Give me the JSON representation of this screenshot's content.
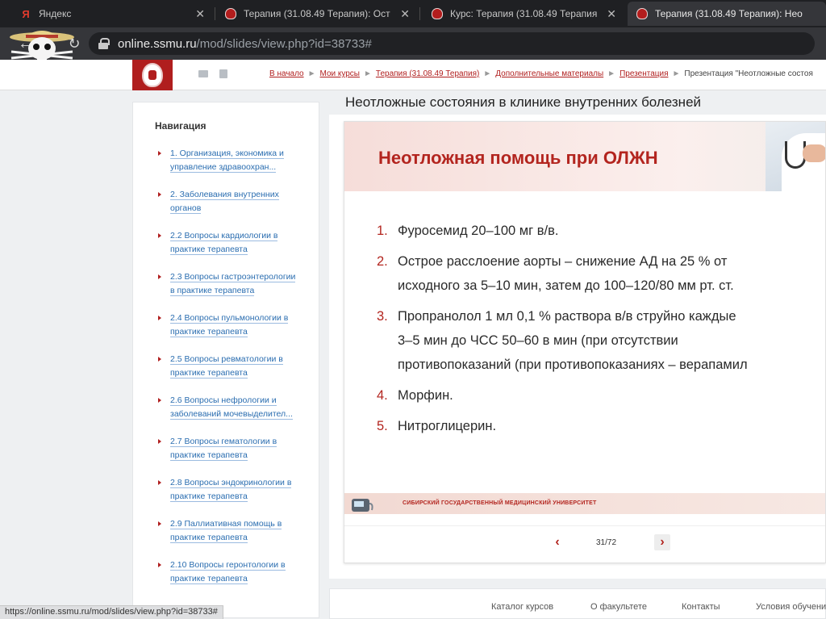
{
  "browser": {
    "tabs": [
      {
        "icon": "yandex-icon",
        "title": "Яндекс"
      },
      {
        "icon": "ssmu-crest-icon",
        "title": "Терапия (31.08.49 Терапия): Ост"
      },
      {
        "icon": "ssmu-crest-icon",
        "title": "Курс: Терапия (31.08.49 Терапия"
      },
      {
        "icon": "ssmu-crest-icon",
        "title": "Терапия (31.08.49 Терапия): Нео"
      }
    ],
    "url_host": "online.ssmu.ru",
    "url_path": "/mod/slides/view.php?id=38733#",
    "status_url": "https://online.ssmu.ru/mod/slides/view.php?id=38733#"
  },
  "header": {
    "breadcrumb": [
      "В начало",
      "Мои курсы",
      "Терапия (31.08.49 Терапия)",
      "Дополнительные материалы",
      "Презентация"
    ],
    "breadcrumb_current": "Презентация \"Неотложные состоя"
  },
  "sidebar": {
    "title": "Навигация",
    "items": [
      {
        "label": "1. Организация, экономика и управление здравоохран..."
      },
      {
        "label": "2. Заболевания внутренних органов"
      },
      {
        "label": "2.2 Вопросы кардиологии в практике терапевта"
      },
      {
        "label": "2.3 Вопросы гастроэнтерологии в практике терапевта"
      },
      {
        "label": "2.4 Вопросы пульмонологии в практике терапевта"
      },
      {
        "label": "2.5 Вопросы ревматологии в практике терапевта"
      },
      {
        "label": "2.6 Вопросы нефрологии и заболеваний мочевыделител..."
      },
      {
        "label": "2.7 Вопросы гематологии в практике терапевта"
      },
      {
        "label": "2.8 Вопросы эндокринологии в практике терапевта"
      },
      {
        "label": "2.9 Паллиативная помощь в практике терапевта"
      },
      {
        "label": "2.10 Вопросы геронтологии в практике терапевта"
      }
    ]
  },
  "main": {
    "page_title": "Неотложные состояния в клинике внутренних болезней",
    "slide": {
      "heading": "Неотложная помощь при ОЛЖН",
      "items": [
        {
          "num": "1.",
          "lines": [
            "Фуросемид 20–100 мг в/в."
          ]
        },
        {
          "num": "2.",
          "lines": [
            "Острое расслоение аорты – снижение АД на 25 % от",
            "исходного за 5–10 мин, затем до 100–120/80 мм рт. ст."
          ]
        },
        {
          "num": "3.",
          "lines": [
            "Пропранолол 1 мл 0,1 % раствора в/в струйно каждые",
            "3–5 мин до ЧСС 50–60 в мин (при отсутствии",
            "противопоказаний (при противопоказаниях – верапамил"
          ]
        },
        {
          "num": "4.",
          "lines": [
            "Морфин."
          ]
        },
        {
          "num": "5.",
          "lines": [
            "Нитроглицерин."
          ]
        }
      ],
      "footer_text": "СИБИРСКИЙ ГОСУДАРСТВЕННЫЙ МЕДИЦИНСКИЙ УНИВЕРСИТЕТ"
    },
    "pager": {
      "prev": "‹",
      "next": "›",
      "count": "31/72"
    }
  },
  "footer": {
    "links": [
      "Каталог курсов",
      "О факультете",
      "Контакты",
      "Условия обучени"
    ]
  },
  "colors": {
    "brand": "#b01e1e",
    "link": "#2a6db0",
    "accent_red": "#b3251f"
  }
}
